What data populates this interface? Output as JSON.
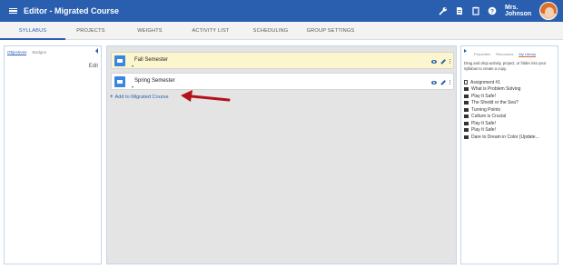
{
  "header": {
    "title": "Editor - Migrated Course",
    "user_name": "Mrs. Johnson",
    "icons": [
      "wrench-icon",
      "document-icon",
      "clipboard-icon",
      "help-icon"
    ]
  },
  "tabs": [
    {
      "label": "SYLLABUS"
    },
    {
      "label": "PROJECTS"
    },
    {
      "label": "WEIGHTS"
    },
    {
      "label": "ACTIVITY LIST"
    },
    {
      "label": "SCHEDULING"
    },
    {
      "label": "GROUP SETTINGS"
    }
  ],
  "left_panel": {
    "tabs": [
      {
        "label": "Objectives"
      },
      {
        "label": "Badges"
      }
    ],
    "edit_label": "Edit"
  },
  "main": {
    "courses": [
      {
        "name": "Fall Semester"
      },
      {
        "name": "Spring Semester"
      }
    ],
    "add_label": "Add to Migrated Course"
  },
  "right_panel": {
    "tabs": [
      {
        "label": "Properties"
      },
      {
        "label": "Resources"
      },
      {
        "label": "My Library"
      }
    ],
    "instructions": "Drag and drop activity, project, or folder into your syllabus to create a copy.",
    "library": [
      {
        "label": "Assignment #1",
        "icon": "document-icon"
      },
      {
        "label": "What is Problem Solving",
        "icon": "folder-icon"
      },
      {
        "label": "Play It Safe!",
        "icon": "folder-icon"
      },
      {
        "label": "The Shedd or the Sea?",
        "icon": "folder-icon"
      },
      {
        "label": "Turning Points",
        "icon": "folder-icon"
      },
      {
        "label": "Culture is Crucial",
        "icon": "folder-icon"
      },
      {
        "label": "Play It Safe!",
        "icon": "folder-icon"
      },
      {
        "label": "Play It Safe!",
        "icon": "folder-icon"
      },
      {
        "label": "Dare to Dream in Color (Update...",
        "icon": "folder-icon"
      }
    ]
  },
  "colors": {
    "brand": "#2a5fb0",
    "highlight": "#fcf6cf",
    "arrow": "#b3121a",
    "panel_bg": "#e4e4e4"
  }
}
